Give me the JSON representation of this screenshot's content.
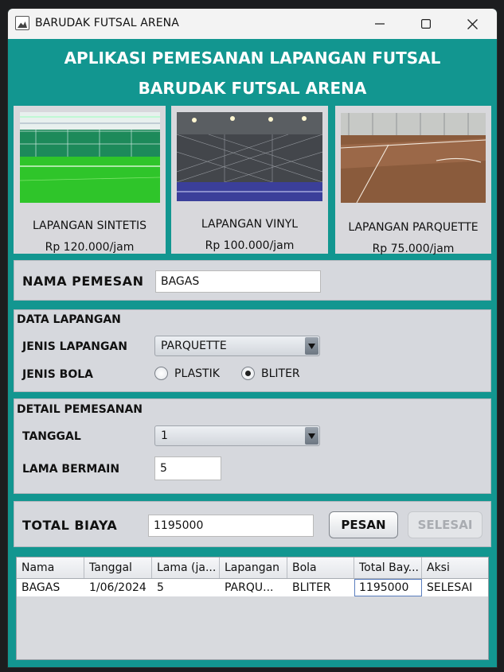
{
  "window": {
    "title": "BARUDAK FUTSAL ARENA",
    "controls": [
      "minimize-icon",
      "maximize-icon",
      "close-icon"
    ]
  },
  "header": {
    "line1": "APLIKASI PEMESANAN LAPANGAN FUTSAL",
    "line2": "BARUDAK FUTSAL ARENA"
  },
  "fields": [
    {
      "name": "LAPANGAN SINTETIS",
      "price": "Rp 120.000/jam"
    },
    {
      "name": "LAPANGAN VINYL",
      "price": "Rp 100.000/jam"
    },
    {
      "name": "LAPANGAN PARQUETTE",
      "price": "Rp 75.000/jam"
    }
  ],
  "customer": {
    "label": "NAMA PEMESAN",
    "value": "BAGAS"
  },
  "field_data": {
    "section_title": "DATA LAPANGAN",
    "type_label": "JENIS LAPANGAN",
    "type_value": "PARQUETTE",
    "ball_label": "JENIS BOLA",
    "ball_options": [
      "PLASTIK",
      "BLITER"
    ],
    "ball_selected": "BLITER"
  },
  "booking": {
    "section_title": "DETAIL PEMESANAN",
    "date_label": "TANGGAL",
    "date_value": "1",
    "duration_label": "LAMA BERMAIN",
    "duration_value": "5"
  },
  "total": {
    "label": "TOTAL BIAYA",
    "value": "1195000",
    "order_button": "PESAN",
    "finish_button": "SELESAI",
    "finish_enabled": false
  },
  "table": {
    "columns": [
      "Nama",
      "Tanggal",
      "Lama (ja...",
      "Lapangan",
      "Bola",
      "Total Bay...",
      "Aksi"
    ],
    "rows": [
      [
        "BAGAS",
        "1/06/2024",
        "5",
        "PARQU...",
        "BLITER",
        "1195000",
        "SELESAI"
      ]
    ]
  },
  "colors": {
    "accent": "#129690",
    "panel": "#d6d8dd"
  }
}
